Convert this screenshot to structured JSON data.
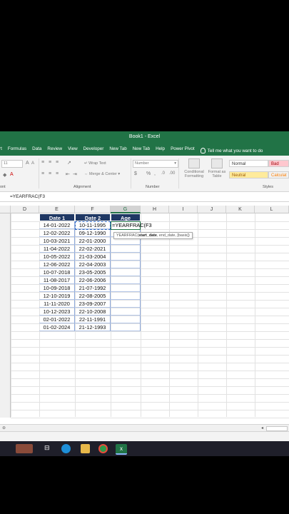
{
  "window": {
    "title": "Book1 - Excel"
  },
  "tabs": [
    "rt",
    "Formulas",
    "Data",
    "Review",
    "View",
    "Developer",
    "New Tab",
    "New Tab",
    "Help",
    "Power Pivot",
    "Tell me what you want to do"
  ],
  "ribbon": {
    "font_size": "11",
    "wrap_text": "Wrap Text",
    "merge_center": "Merge & Center",
    "number_format": "Number",
    "currency_symbol": "$",
    "percent_symbol": "%",
    "comma_symbol": ",",
    "conditional_formatting": "Conditional Formatting",
    "format_as_table": "Format as Table",
    "styles": [
      "Normal",
      "Bad",
      "Neutral",
      "Calculat"
    ],
    "groups": {
      "font": "ont",
      "alignment": "Alignment",
      "number": "Number",
      "styles": "Styles"
    }
  },
  "formula_bar": {
    "content": "=YEARFRAC(F3"
  },
  "grid": {
    "columns": [
      "D",
      "E",
      "F",
      "G",
      "H",
      "I",
      "J",
      "K",
      "L"
    ],
    "selected_column": "G",
    "headers": [
      "Date 1",
      "Date 2",
      "Age"
    ],
    "rows": [
      [
        "14-01-2022",
        "10-11-1995"
      ],
      [
        "12-02-2022",
        "09-12-1990"
      ],
      [
        "10-03-2021",
        "22-01-2000"
      ],
      [
        "11-04-2022",
        "22-02-2021"
      ],
      [
        "10-05-2022",
        "21-03-2004"
      ],
      [
        "12-06-2022",
        "22-04-2003"
      ],
      [
        "10-07-2018",
        "23-05-2005"
      ],
      [
        "11-08-2017",
        "22-06-2006"
      ],
      [
        "10-09-2018",
        "21-07-1992"
      ],
      [
        "12-10-2019",
        "22-08-2005"
      ],
      [
        "11-11-2020",
        "23-09-2007"
      ],
      [
        "10-12-2023",
        "22-10-2008"
      ],
      [
        "02-01-2022",
        "22-11-1991"
      ],
      [
        "01-02-2024",
        "21-12-1993"
      ]
    ],
    "active_cell_text": "=YEARFRAC(F3",
    "tooltip": {
      "fn": "YEARFRAC(",
      "arg_bold": "start_date",
      "rest": ", end_date, [basis])"
    }
  },
  "colors": {
    "excel_green": "#217346",
    "header_fill": "#1f3864",
    "taskbar": "#1f1f2a"
  }
}
